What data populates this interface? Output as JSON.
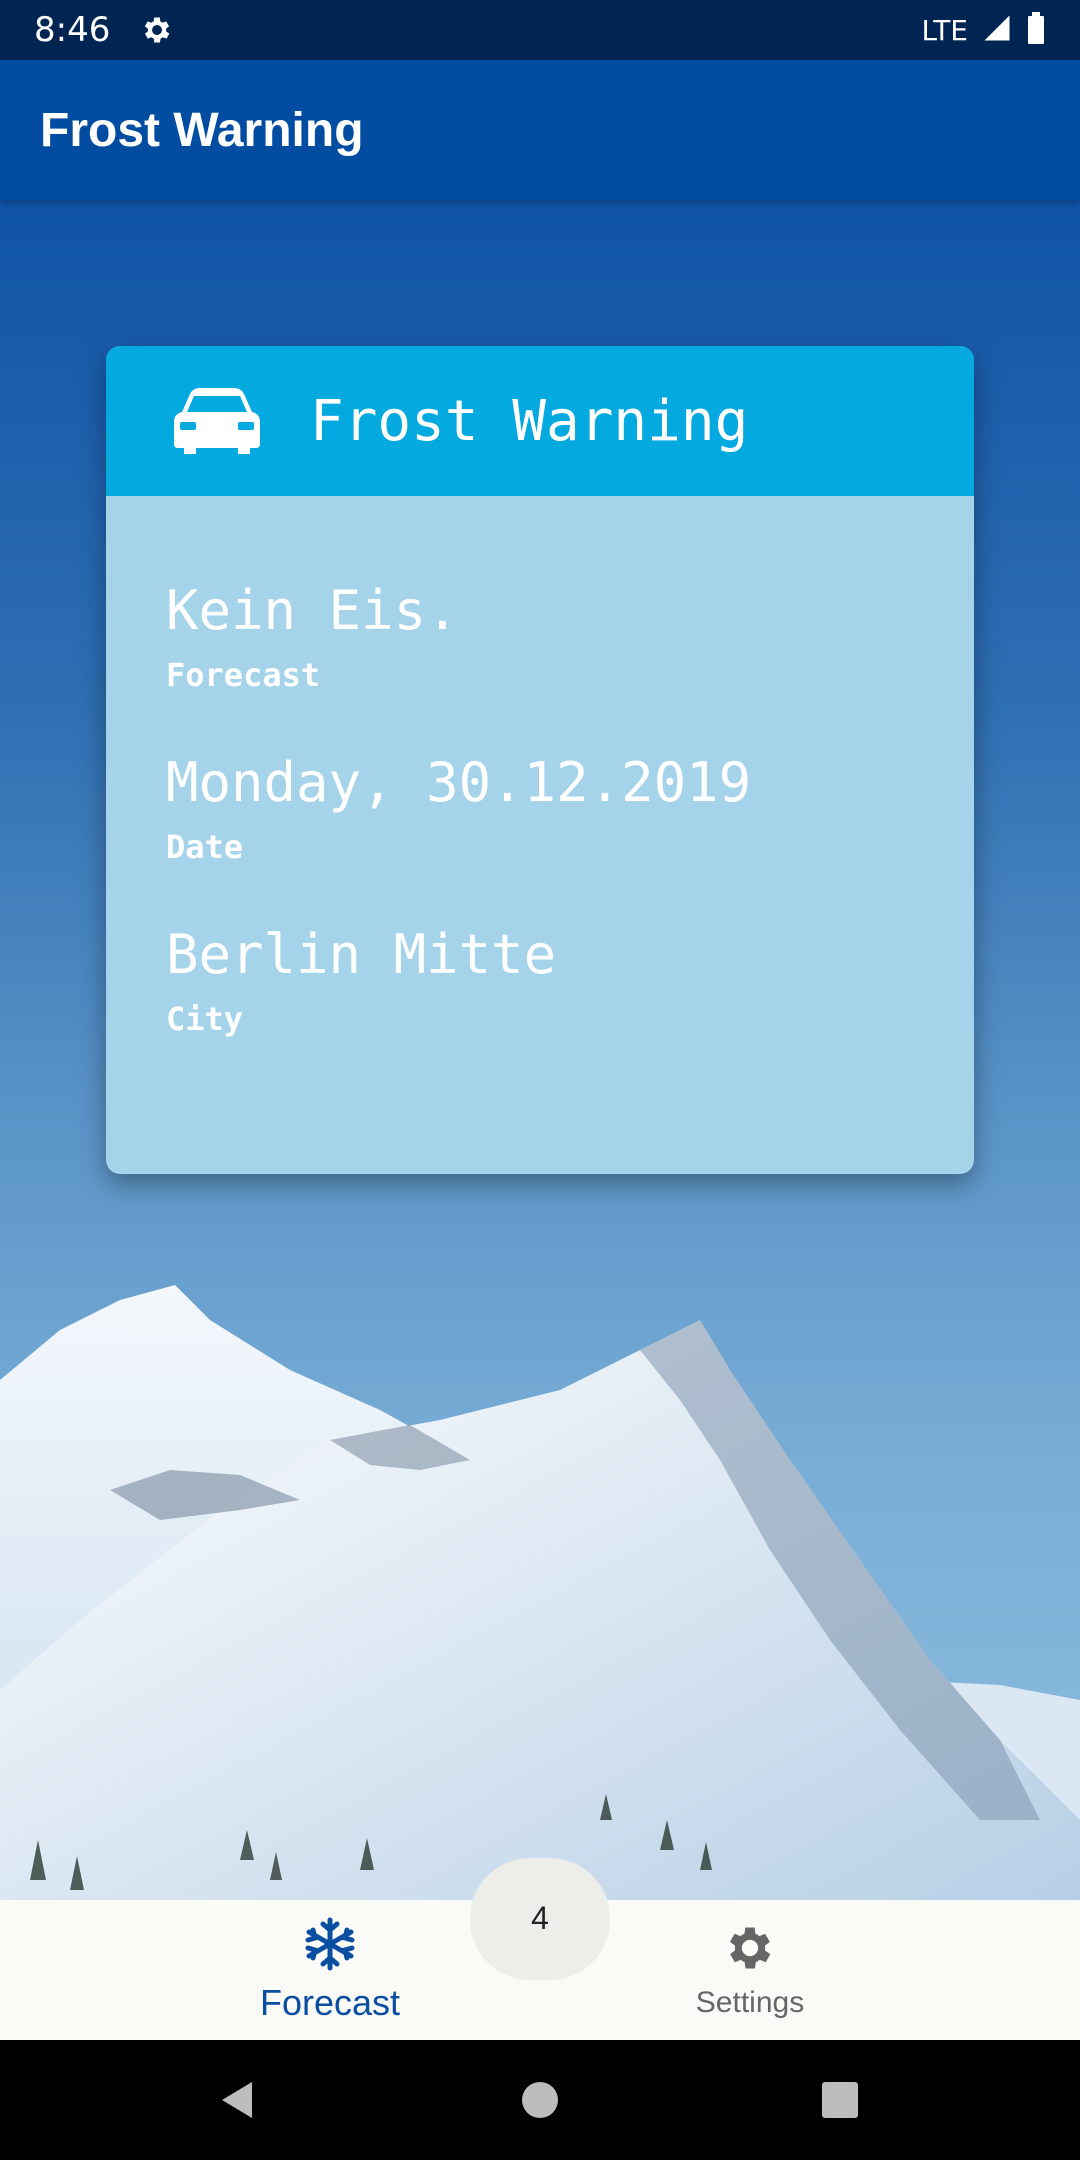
{
  "status_bar": {
    "time": "8:46",
    "network": "LTE",
    "icons": [
      "gear-icon",
      "signal-icon",
      "battery-icon"
    ]
  },
  "app_bar": {
    "title": "Frost Warning"
  },
  "card": {
    "title": "Frost Warning",
    "icon": "car-icon",
    "fields": [
      {
        "value": "Kein Eis.",
        "label": "Forecast"
      },
      {
        "value": "Monday, 30.12.2019",
        "label": "Date"
      },
      {
        "value": "Berlin Mitte",
        "label": "City"
      }
    ]
  },
  "bottom_nav": {
    "items": [
      {
        "label": "Forecast",
        "icon": "snowflake-icon",
        "active": true
      },
      {
        "label": "Settings",
        "icon": "gear-icon",
        "active": false
      }
    ],
    "badge": "4"
  },
  "colors": {
    "status_bar": "#012553",
    "app_bar": "#024da1",
    "card_header": "#03a9df",
    "card_body": "#a5d4ea",
    "active_nav": "#0a4ea2"
  }
}
